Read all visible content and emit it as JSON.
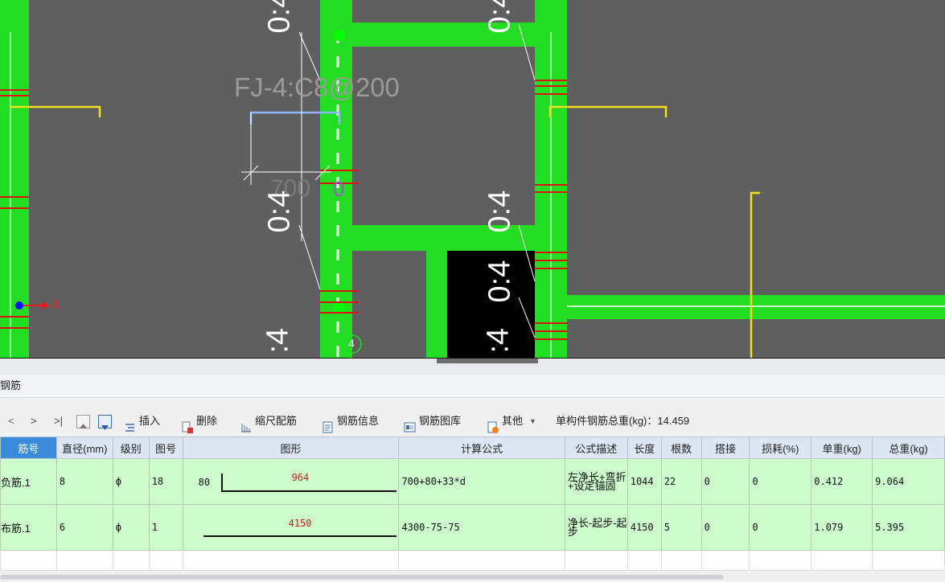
{
  "canvas": {
    "background": "#5f5f5f",
    "labels": {
      "rebar_label": "FJ-4:C8@200",
      "dim_value": "700",
      "dim_zero": "0",
      "v1": "0:4",
      "v2": "0:4",
      "v3": "0:4",
      "v4": "0:4",
      "v5": "0:4",
      "v6": "0:4",
      "bottom_a": ":4",
      "bottom_b": ":4",
      "axis_marker": "4",
      "axis_x": "X"
    }
  },
  "panel": {
    "title": "钢筋"
  },
  "toolbar": {
    "nav_first": "<",
    "nav_next": ">",
    "nav_last": ">|",
    "insert": "插入",
    "delete": "删除",
    "scale_rebar": "缩尺配筋",
    "rebar_info": "钢筋信息",
    "rebar_library": "钢筋图库",
    "other": "其他",
    "total_weight_label": "单构件钢筋总重(kg)：14.459"
  },
  "table": {
    "headers": [
      "筋号",
      "直径(mm)",
      "级别",
      "图号",
      "图形",
      "计算公式",
      "公式描述",
      "长度",
      "根数",
      "搭接",
      "损耗(%)",
      "单重(kg)",
      "总重(kg)"
    ],
    "rows": [
      {
        "name": "负筋.1",
        "diameter": "8",
        "grade": "ф",
        "fig_no": "18",
        "shape_left": "80",
        "shape_value": "964",
        "formula": "700+80+33*d",
        "desc": "左净长+弯折+设定锚固",
        "length": "1044",
        "count": "22",
        "lap": "0",
        "loss": "0",
        "unit_weight": "0.412",
        "total_weight": "9.064"
      },
      {
        "name": "布筋.1",
        "diameter": "6",
        "grade": "ф",
        "fig_no": "1",
        "shape_left": "",
        "shape_value": "4150",
        "formula": "4300-75-75",
        "desc": "净长-起步-起步",
        "length": "4150",
        "count": "5",
        "lap": "0",
        "loss": "0",
        "unit_weight": "1.079",
        "total_weight": "5.395"
      }
    ]
  },
  "colors": {
    "green": "#22dd22",
    "red": "#dd1111",
    "yellow": "#f0e020",
    "header_selected": "#3b8bdc",
    "row_bg": "#ccfccc"
  }
}
